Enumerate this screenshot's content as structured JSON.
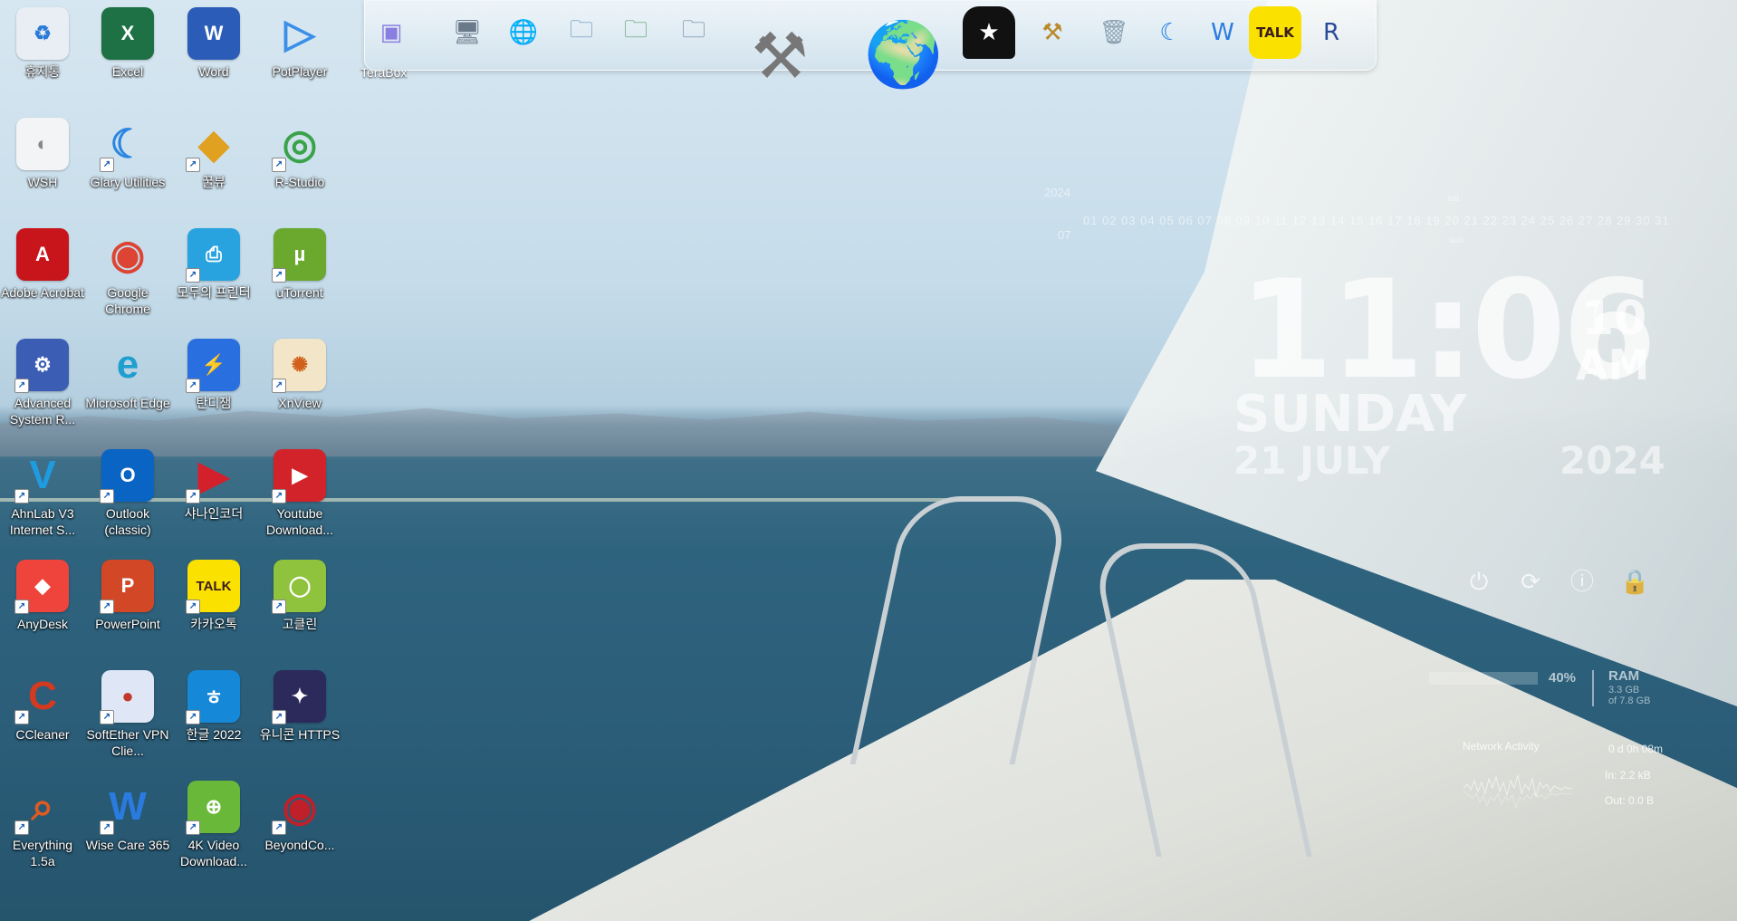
{
  "desktop_icons": [
    {
      "label": "휴지통",
      "icon": "recycle-bin-icon",
      "bg": "#e8eef3",
      "fg": "#2b7bd6",
      "glyph": "♻",
      "col": 0,
      "row": 0,
      "shortcut": false
    },
    {
      "label": "Excel",
      "icon": "excel-icon",
      "bg": "#1d7144",
      "fg": "#ffffff",
      "glyph": "X",
      "col": 1,
      "row": 0,
      "shortcut": false
    },
    {
      "label": "Word",
      "icon": "word-icon",
      "bg": "#2b5cb8",
      "fg": "#ffffff",
      "glyph": "W",
      "col": 2,
      "row": 0,
      "shortcut": false
    },
    {
      "label": "PotPlayer",
      "icon": "potplayer-icon",
      "bg": "transparent",
      "fg": "#3b8fe8",
      "glyph": "▷",
      "col": 3,
      "row": 0,
      "shortcut": false
    },
    {
      "label": "WSH",
      "icon": "wsh-file-icon",
      "bg": "#f3f4f5",
      "fg": "#888888",
      "glyph": "◐",
      "col": 0,
      "row": 1,
      "shortcut": false
    },
    {
      "label": "Glary Utilities",
      "icon": "glary-utilities-icon",
      "bg": "transparent",
      "fg": "#2a86e0",
      "glyph": "☾",
      "col": 1,
      "row": 1,
      "shortcut": true
    },
    {
      "label": "꿀뷰",
      "icon": "honeyview-icon",
      "bg": "transparent",
      "fg": "#e0a020",
      "glyph": "◆",
      "col": 2,
      "row": 1,
      "shortcut": true
    },
    {
      "label": "R-Studio",
      "icon": "r-studio-icon",
      "bg": "transparent",
      "fg": "#3aa34a",
      "glyph": "◎",
      "col": 3,
      "row": 1,
      "shortcut": true
    },
    {
      "label": "Adobe Acrobat",
      "icon": "adobe-acrobat-icon",
      "bg": "#c8141b",
      "fg": "#ffffff",
      "glyph": "A",
      "col": 0,
      "row": 2,
      "shortcut": false
    },
    {
      "label": "Google Chrome",
      "icon": "google-chrome-icon",
      "bg": "transparent",
      "fg": "#dd4433",
      "glyph": "◉",
      "col": 1,
      "row": 2,
      "shortcut": false
    },
    {
      "label": "모두의 프린터",
      "icon": "printer-icon",
      "bg": "#29a3e0",
      "fg": "#ffffff",
      "glyph": "⎙",
      "col": 2,
      "row": 2,
      "shortcut": true
    },
    {
      "label": "uTorrent",
      "icon": "utorrent-icon",
      "bg": "#6aa82e",
      "fg": "#ffffff",
      "glyph": "µ",
      "col": 3,
      "row": 2,
      "shortcut": true
    },
    {
      "label": "Advanced System R...",
      "icon": "advanced-system-repair-icon",
      "bg": "#3b5db4",
      "fg": "#ffffff",
      "glyph": "⚙",
      "col": 0,
      "row": 3,
      "shortcut": true
    },
    {
      "label": "Microsoft Edge",
      "icon": "microsoft-edge-icon",
      "bg": "transparent",
      "fg": "#1f9fd0",
      "glyph": "e",
      "col": 1,
      "row": 3,
      "shortcut": false
    },
    {
      "label": "탄디잼",
      "icon": "bandizip-icon",
      "bg": "#2a6fe0",
      "fg": "#ffffff",
      "glyph": "⚡",
      "col": 2,
      "row": 3,
      "shortcut": true
    },
    {
      "label": "XnView",
      "icon": "xnview-icon",
      "bg": "#f3e6c8",
      "fg": "#d0601a",
      "glyph": "✺",
      "col": 3,
      "row": 3,
      "shortcut": true
    },
    {
      "label": "AhnLab V3 Internet S...",
      "icon": "ahnlab-v3-icon",
      "bg": "transparent",
      "fg": "#1f9be0",
      "glyph": "V",
      "col": 0,
      "row": 4,
      "shortcut": true
    },
    {
      "label": "Outlook (classic)",
      "icon": "outlook-icon",
      "bg": "#0a64c4",
      "fg": "#ffffff",
      "glyph": "O",
      "col": 1,
      "row": 4,
      "shortcut": true
    },
    {
      "label": "샤나인코더",
      "icon": "shana-encoder-icon",
      "bg": "transparent",
      "fg": "#d4202a",
      "glyph": "▶",
      "col": 2,
      "row": 4,
      "shortcut": true
    },
    {
      "label": "Youtube Download...",
      "icon": "youtube-downloader-icon",
      "bg": "#d2232a",
      "fg": "#ffffff",
      "glyph": "▶",
      "col": 3,
      "row": 4,
      "shortcut": true
    },
    {
      "label": "AnyDesk",
      "icon": "anydesk-icon",
      "bg": "#ef443b",
      "fg": "#ffffff",
      "glyph": "◆",
      "col": 0,
      "row": 5,
      "shortcut": true
    },
    {
      "label": "PowerPoint",
      "icon": "powerpoint-icon",
      "bg": "#d24726",
      "fg": "#ffffff",
      "glyph": "P",
      "col": 1,
      "row": 5,
      "shortcut": true
    },
    {
      "label": "카카오톡",
      "icon": "kakaotalk-icon",
      "bg": "#fae100",
      "fg": "#3a1d1d",
      "glyph": "TALK",
      "col": 2,
      "row": 5,
      "shortcut": true
    },
    {
      "label": "고클린",
      "icon": "goclean-icon",
      "bg": "#8fc23d",
      "fg": "#ffffff",
      "glyph": "◯",
      "col": 3,
      "row": 5,
      "shortcut": true
    },
    {
      "label": "CCleaner",
      "icon": "ccleaner-icon",
      "bg": "transparent",
      "fg": "#d43a1f",
      "glyph": "C",
      "col": 0,
      "row": 6,
      "shortcut": true
    },
    {
      "label": "SoftEther VPN Clie...",
      "icon": "softether-vpn-icon",
      "bg": "#dfe6f5",
      "fg": "#c0392b",
      "glyph": "●",
      "col": 1,
      "row": 6,
      "shortcut": true
    },
    {
      "label": "한글 2022",
      "icon": "hangul-2022-icon",
      "bg": "#1688d8",
      "fg": "#ffffff",
      "glyph": "ㅎ",
      "col": 2,
      "row": 6,
      "shortcut": true
    },
    {
      "label": "유니콘 HTTPS",
      "icon": "unicorn-https-icon",
      "bg": "#2c2a5a",
      "fg": "#ffffff",
      "glyph": "✦",
      "col": 3,
      "row": 6,
      "shortcut": true
    },
    {
      "label": "Everything 1.5a",
      "icon": "everything-search-icon",
      "bg": "transparent",
      "fg": "#e05a20",
      "glyph": "⌕",
      "col": 0,
      "row": 7,
      "shortcut": true
    },
    {
      "label": "Wise Care 365",
      "icon": "wise-care-365-icon",
      "bg": "transparent",
      "fg": "#2a7be0",
      "glyph": "W",
      "col": 1,
      "row": 7,
      "shortcut": true
    },
    {
      "label": "4K Video Download...",
      "icon": "4k-video-downloader-icon",
      "bg": "#6ab83a",
      "fg": "#ffffff",
      "glyph": "⊕",
      "col": 2,
      "row": 7,
      "shortcut": true
    },
    {
      "label": "BeyondCo...",
      "icon": "beyond-compare-icon",
      "bg": "transparent",
      "fg": "#c0202a",
      "glyph": "◉",
      "col": 3,
      "row": 7,
      "shortcut": true
    }
  ],
  "dock": {
    "label": "TeraBox",
    "items": [
      {
        "icon": "terabox-icon",
        "glyph": "▣",
        "color": "#8a7fe0"
      },
      {
        "icon": "network-computer-icon",
        "glyph": "🖥",
        "color": "#6a7a8a"
      },
      {
        "icon": "globe-network-icon",
        "glyph": "🌐",
        "color": "#3a7ac0"
      },
      {
        "icon": "folder-icon",
        "glyph": "🗀",
        "color": "#6a90b8"
      },
      {
        "icon": "folder-green-icon",
        "glyph": "🗀",
        "color": "#5a9a6a"
      },
      {
        "icon": "folder-photos-icon",
        "glyph": "🗀",
        "color": "#6a80a0"
      },
      {
        "icon": "system-tools-icon",
        "glyph": "⚒",
        "color": "#777777"
      },
      {
        "icon": "globe-browser-icon",
        "glyph": "🌍",
        "color": "#2a6ab8"
      },
      {
        "icon": "tshirt-icon",
        "glyph": "★",
        "color": "#111111"
      },
      {
        "icon": "hammer-tools-icon",
        "glyph": "⚒",
        "color": "#b88a2a"
      },
      {
        "icon": "trash-icon",
        "glyph": "🗑",
        "color": "#8aa0b0"
      },
      {
        "icon": "glary-moon-icon",
        "glyph": "☾",
        "color": "#1a7ae0"
      },
      {
        "icon": "wise-shield-icon",
        "glyph": "W",
        "color": "#2a7be0"
      },
      {
        "icon": "kakaotalk-dock-icon",
        "glyph": "TALK",
        "color": "#3a1d1d"
      },
      {
        "icon": "r-restore-icon",
        "glyph": "R",
        "color": "#2a4a9a"
      }
    ]
  },
  "calendar": {
    "year": "2024",
    "month": "07",
    "days": "01 02 03 04 05 06 07 08 09 10 11 12 13 14 15 16 17 18 19 20 21 22 23 24 25 26 27 28 29 30 31",
    "weekday_marker": "sun",
    "weekday_top": "sat"
  },
  "clock": {
    "time": "11:06",
    "seconds": "10",
    "ampm": "AM",
    "day": "SUNDAY",
    "date": "21 JULY",
    "year": "2024"
  },
  "system": {
    "cpu_percent_label": "40%",
    "ram_label": "RAM",
    "ram_used": "3.3 GB",
    "ram_total": "of 7.8 GB",
    "network_title": "Network Activity",
    "uptime": "0 d 0h 08m",
    "net_in": "In: 2.2 kB",
    "net_out": "Out: 0.0 B"
  },
  "colors": {
    "widget_text": "#ffffff",
    "label_text": "#ffffff"
  }
}
